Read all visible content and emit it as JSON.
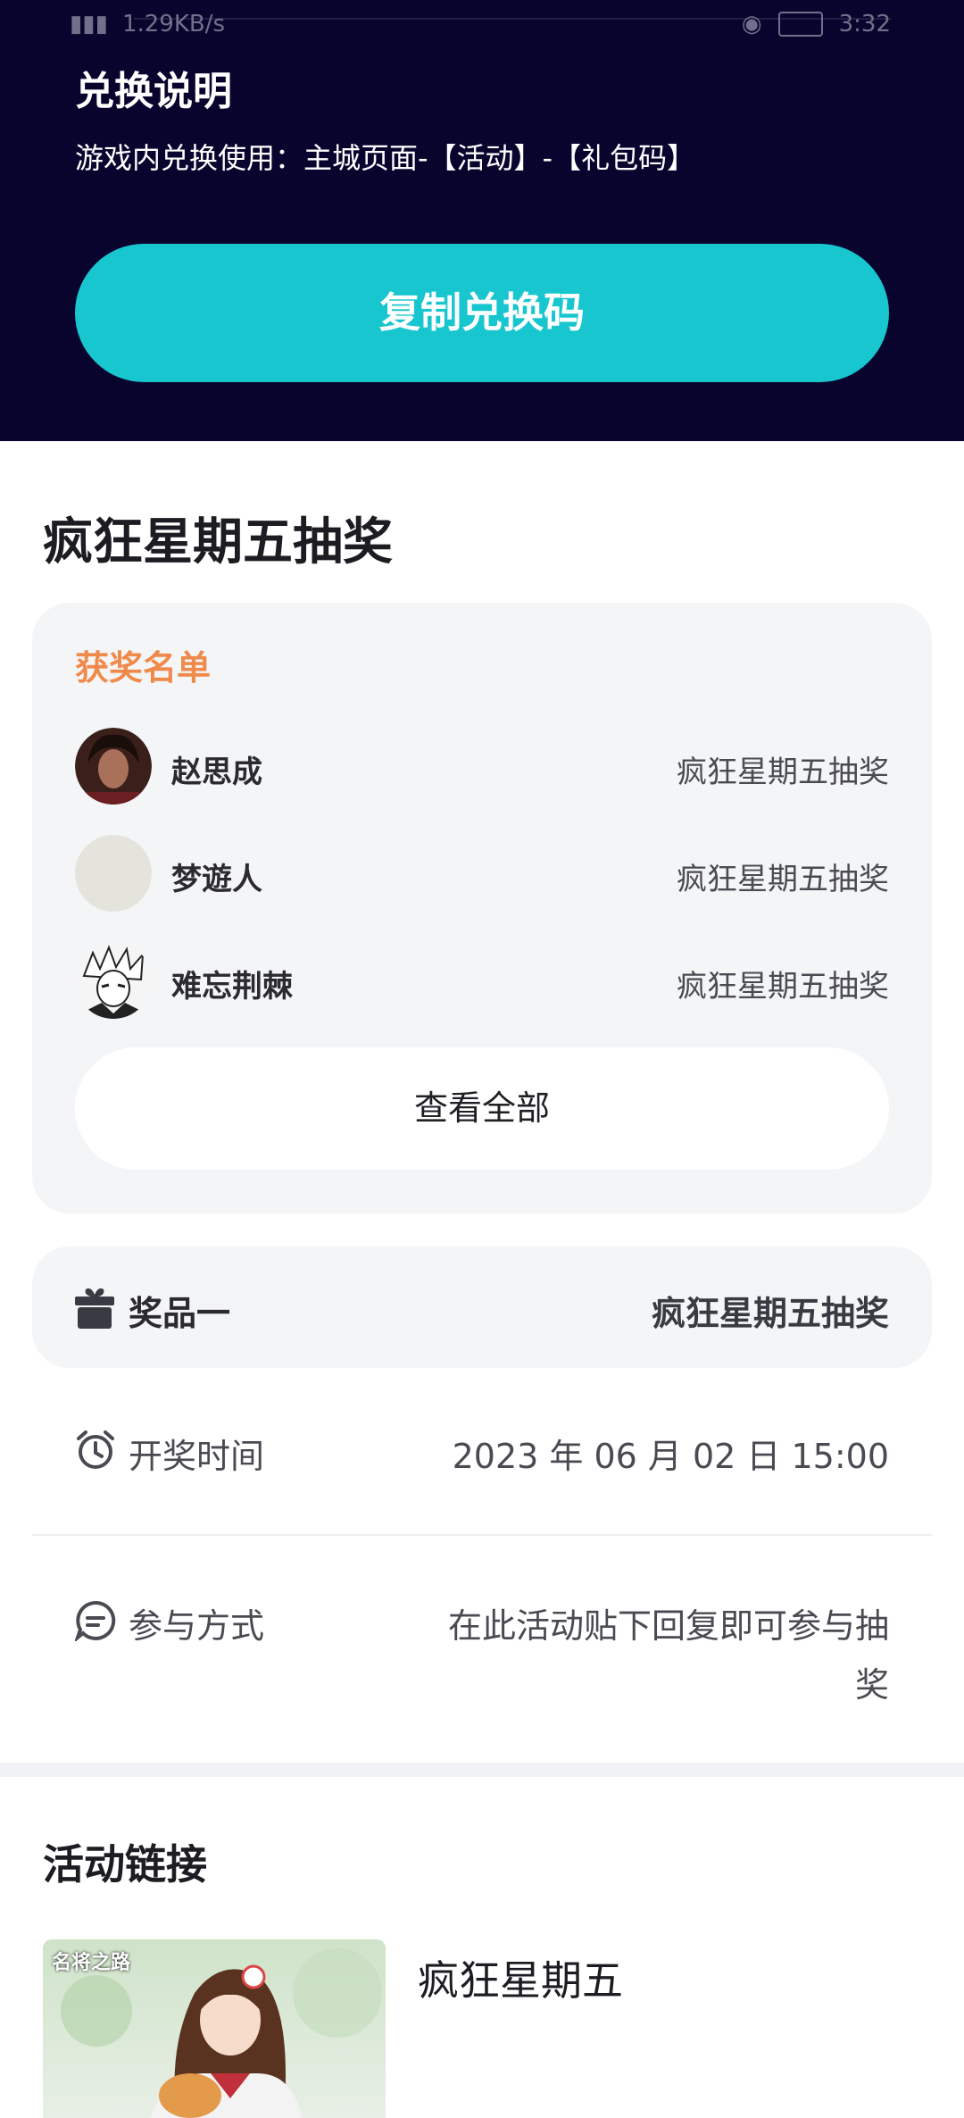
{
  "statusbar": {
    "network": "1.29KB/s",
    "time": "3:32"
  },
  "redeem": {
    "title": "兑换说明",
    "description": "游戏内兑换使用：主城页面-【活动】-【礼包码】",
    "copy_button": "复制兑换码"
  },
  "lottery": {
    "title": "疯狂星期五抽奖",
    "winners_title": "获奖名单",
    "winners": [
      {
        "name": "赵思成",
        "prize": "疯狂星期五抽奖"
      },
      {
        "name": "梦遊人",
        "prize": "疯狂星期五抽奖"
      },
      {
        "name": "难忘荆棘",
        "prize": "疯狂星期五抽奖"
      }
    ],
    "view_all": "查看全部",
    "prize_label": "奖品一",
    "prize_value": "疯狂星期五抽奖",
    "draw_time_label": "开奖时间",
    "draw_time_value": "2023 年 06 月 02 日 15:00",
    "join_label": "参与方式",
    "join_value_line1": "在此活动贴下回复即可参与抽",
    "join_value_line2": "奖"
  },
  "links": {
    "title": "活动链接",
    "item_title": "疯狂星期五",
    "thumb_logo": "名将之路"
  },
  "colors": {
    "top_bg": "#08042e",
    "accent": "#17c6cf",
    "winners_title": "#f08a4b"
  }
}
